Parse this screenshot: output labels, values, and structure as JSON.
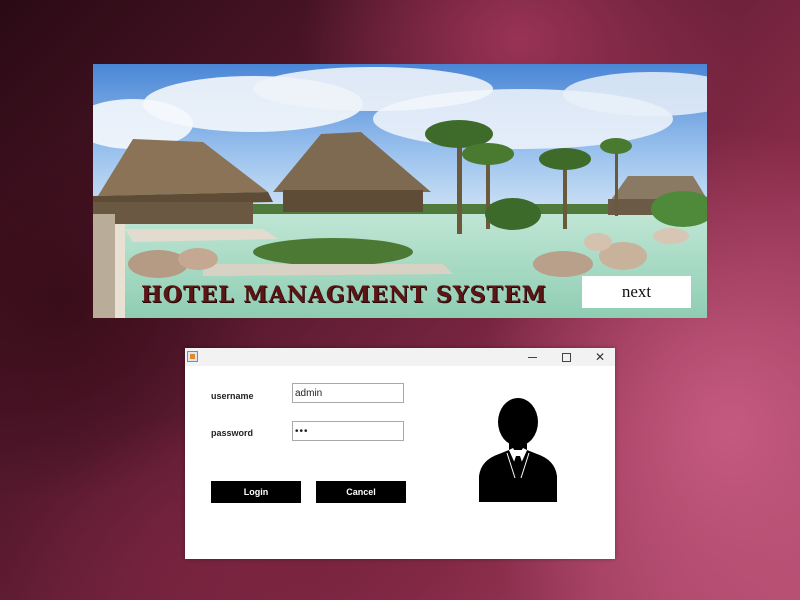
{
  "splash": {
    "title": "HOTEL MANAGMENT SYSTEM",
    "next_label": "next"
  },
  "login": {
    "window_controls": {
      "minimize": "—",
      "maximize": "☐",
      "close": "✕"
    },
    "username_label": "username",
    "username_value": "admin",
    "password_label": "password",
    "password_value": "•••",
    "login_label": "Login",
    "cancel_label": "Cancel",
    "avatar_icon": "businessman-silhouette-icon"
  },
  "colors": {
    "title_text": "#5a1515",
    "button_bg": "#000000",
    "button_text": "#ffffff"
  }
}
